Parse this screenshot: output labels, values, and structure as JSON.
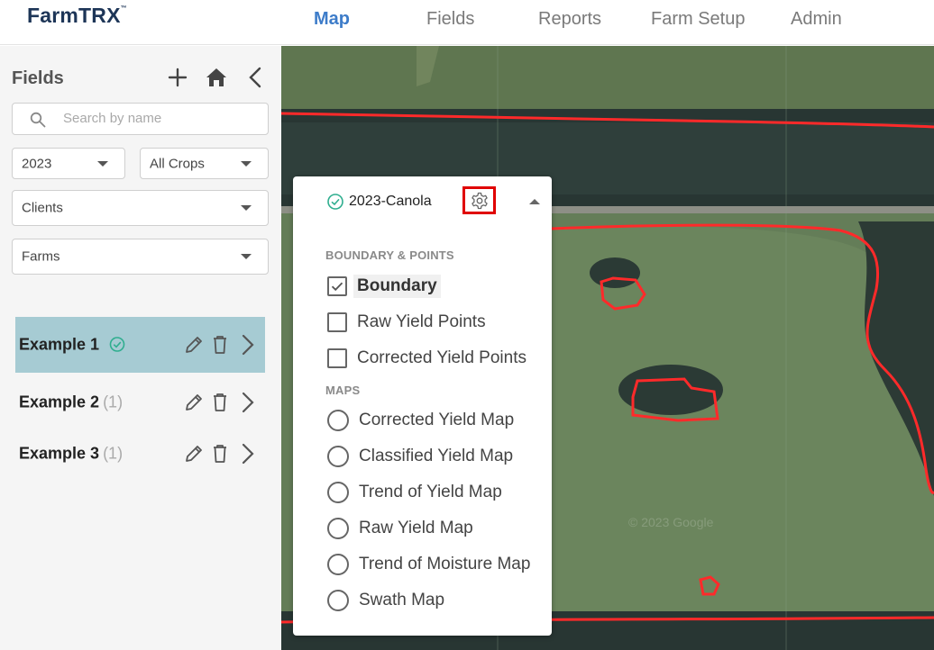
{
  "header": {
    "logo": "FarmTRX",
    "logo_tm": "™",
    "nav": [
      {
        "label": "Map",
        "active": true
      },
      {
        "label": "Fields",
        "active": false
      },
      {
        "label": "Reports",
        "active": false
      },
      {
        "label": "Farm Setup",
        "active": false
      },
      {
        "label": "Admin",
        "active": false
      }
    ]
  },
  "sidebar": {
    "title": "Fields",
    "search_placeholder": "Search by name",
    "year": "2023",
    "crops": "All Crops",
    "clients": "Clients",
    "farms": "Farms",
    "fields": [
      {
        "name": "Example 1",
        "count": "",
        "verified": true,
        "selected": true
      },
      {
        "name": "Example 2",
        "count": "(1)",
        "verified": false,
        "selected": false
      },
      {
        "name": "Example 3",
        "count": "(1)",
        "verified": false,
        "selected": false
      }
    ]
  },
  "layer_panel": {
    "title": "2023-Canola",
    "section_boundary": "BOUNDARY & POINTS",
    "boundary_options": [
      {
        "label": "Boundary",
        "checked": true
      },
      {
        "label": "Raw Yield Points",
        "checked": false
      },
      {
        "label": "Corrected Yield Points",
        "checked": false
      }
    ],
    "section_maps": "MAPS",
    "map_options": [
      {
        "label": "Corrected Yield Map"
      },
      {
        "label": "Classified Yield Map"
      },
      {
        "label": "Trend of Yield Map"
      },
      {
        "label": "Raw Yield Map"
      },
      {
        "label": "Trend of Moisture Map"
      },
      {
        "label": "Swath Map"
      }
    ]
  },
  "map": {
    "watermark": "© 2023 Google",
    "boundary_color": "#ff2a2a"
  },
  "colors": {
    "accent": "#3d7cc9",
    "selected_row": "#a6cbd3",
    "verified": "#2fae8f",
    "highlight_box": "#e00000"
  }
}
